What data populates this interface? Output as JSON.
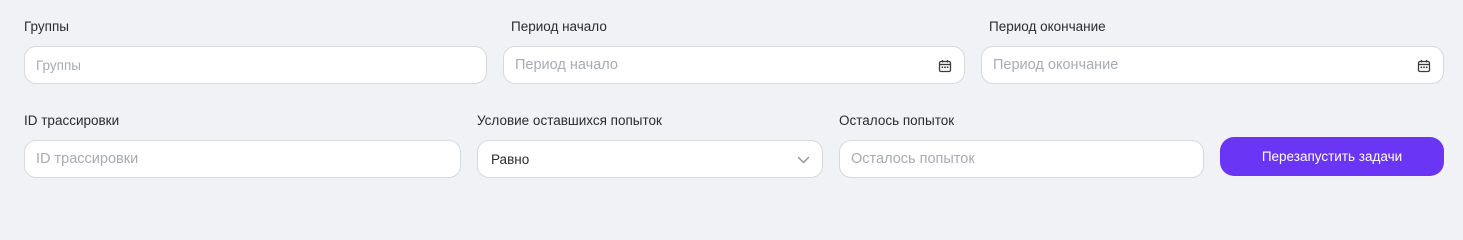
{
  "filters": {
    "groups": {
      "label": "Группы",
      "placeholder": "Группы"
    },
    "period_start": {
      "label": "Период начало",
      "placeholder": "Период начало"
    },
    "period_end": {
      "label": "Период окончание",
      "placeholder": "Период окончание"
    },
    "trace_id": {
      "label": "ID трассировки",
      "placeholder": "ID трассировки"
    },
    "attempts_condition": {
      "label": "Условие оставшихся попыток",
      "value": "Равно"
    },
    "attempts_left": {
      "label": "Осталось попыток",
      "placeholder": "Осталось попыток"
    }
  },
  "actions": {
    "restart_label": "Перезапустить задачи"
  },
  "colors": {
    "background": "#f1f2f5",
    "accent": "#6a35f5",
    "input_border": "#d7d9df"
  },
  "icons": {
    "date_picker": "calendar-icon",
    "select_toggle": "chevron-down-icon"
  }
}
